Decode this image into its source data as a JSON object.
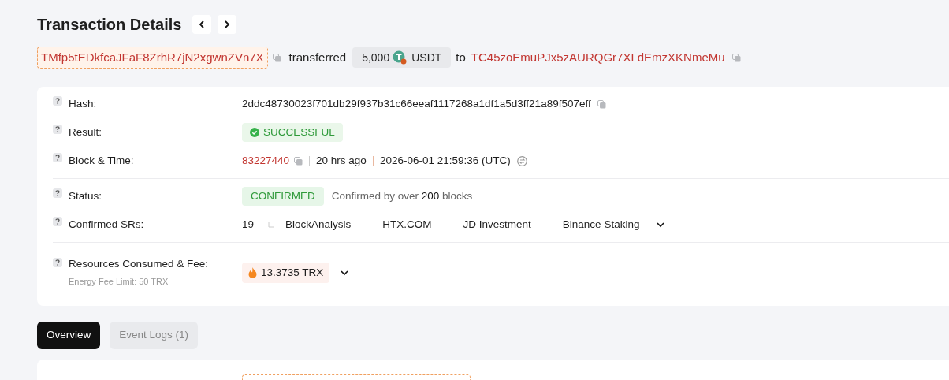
{
  "title": "Transaction Details",
  "transfer": {
    "from": "TMfp5tEDkfcaJFaF8ZrhR7jN2xgwnZVn7X",
    "verb": "transferred",
    "amount": "5,000",
    "token": "USDT",
    "prep": "to",
    "to": "TC45zoEmuPJx5zAURQGr7XLdEmzXKNmeMu"
  },
  "groups": [
    {
      "rows": [
        {
          "kind": "hash",
          "label": "Hash:",
          "value": "2ddc48730023f701db29f937b31c66eeaf1117268a1df1a5d3ff21a89f507eff"
        },
        {
          "kind": "result",
          "label": "Result:",
          "value": "SUCCESSFUL"
        },
        {
          "kind": "block",
          "label": "Block & Time:",
          "block": "83227440",
          "ago": "20 hrs ago",
          "time": "2026-06-01 21:59:36 (UTC)"
        }
      ]
    },
    {
      "rows": [
        {
          "kind": "status",
          "label": "Status:",
          "value": "CONFIRMED",
          "note": "Confirmed by over **200** blocks"
        },
        {
          "kind": "srs",
          "label": "Confirmed SRs:",
          "count": "19",
          "names": [
            "BlockAnalysis",
            "HTX.COM",
            "JD Investment",
            "Binance Staking"
          ]
        }
      ]
    },
    {
      "rows": [
        {
          "kind": "fee",
          "label": "Resources Consumed & Fee:",
          "sublabel": "Energy Fee Limit: 50 TRX",
          "value": "13.3735 TRX"
        }
      ]
    }
  ],
  "tabs": [
    {
      "label": "Overview",
      "selected": true
    },
    {
      "label": "Event Logs (1)",
      "selected": false
    }
  ]
}
